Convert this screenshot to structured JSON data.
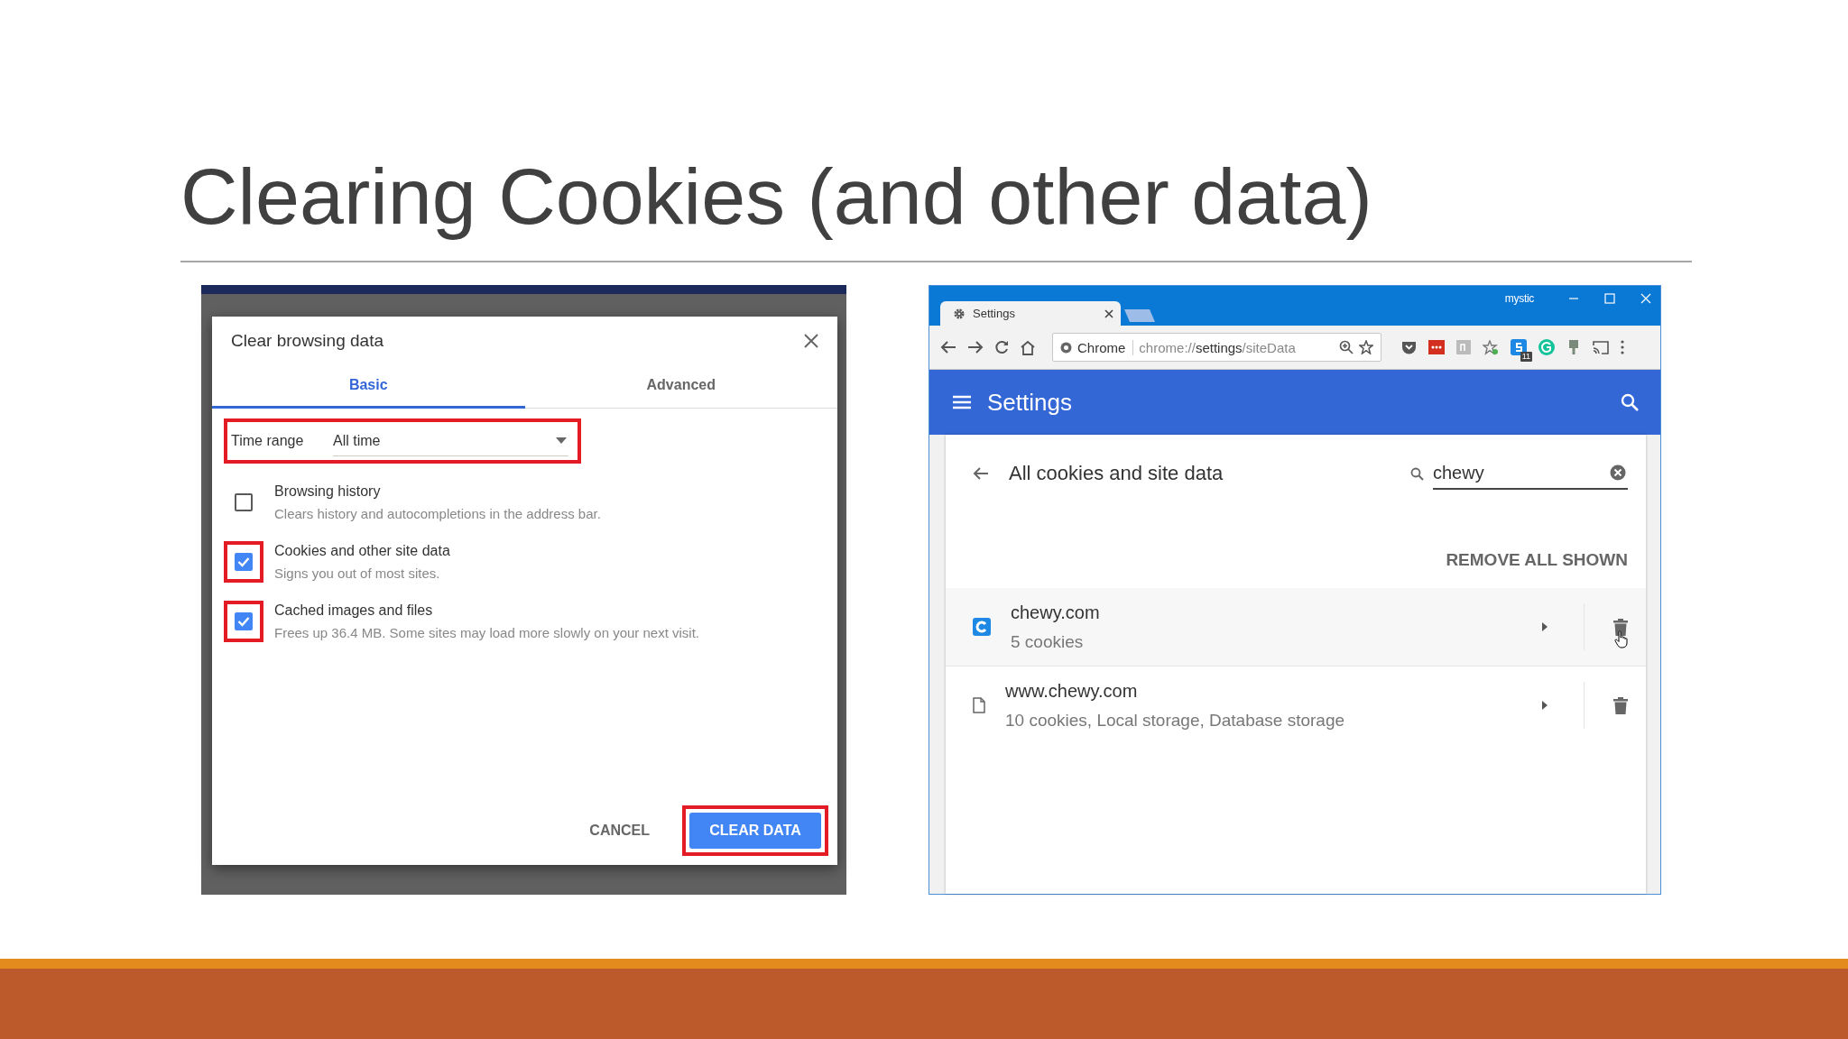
{
  "slide": {
    "title": "Clearing Cookies (and other data)"
  },
  "clear_dialog": {
    "title": "Clear browsing data",
    "tabs": [
      {
        "label": "Basic",
        "selected": true
      },
      {
        "label": "Advanced",
        "selected": false
      }
    ],
    "time_range": {
      "label": "Time range",
      "value": "All time",
      "highlighted": true
    },
    "options": [
      {
        "label": "Browsing history",
        "description": "Clears history and autocompletions in the address bar.",
        "checked": false,
        "highlighted": false
      },
      {
        "label": "Cookies and other site data",
        "description": "Signs you out of most sites.",
        "checked": true,
        "highlighted": true
      },
      {
        "label": "Cached images and files",
        "description": "Frees up 36.4 MB. Some sites may load more slowly on your next visit.",
        "checked": true,
        "highlighted": true
      }
    ],
    "buttons": [
      {
        "label": "CANCEL",
        "kind": "text",
        "highlighted": false
      },
      {
        "label": "CLEAR DATA",
        "kind": "primary",
        "highlighted": true
      }
    ]
  },
  "browser": {
    "tab": {
      "title": "Settings"
    },
    "profile": "mystic",
    "address": {
      "site_label": "Chrome",
      "url": "chrome://**settings**/siteData"
    },
    "extension_badge": "11",
    "header": {
      "title": "Settings"
    },
    "page": {
      "title": "All cookies and site data",
      "search": {
        "value": "chewy"
      },
      "remove_all": "REMOVE ALL SHOWN",
      "sites": [
        {
          "name": "chewy.com",
          "details": "5 cookies",
          "kind": "favicon",
          "hovered": true
        },
        {
          "name": "www.chewy.com",
          "details": "10 cookies, Local storage, Database storage",
          "kind": "file",
          "hovered": false
        }
      ]
    }
  }
}
